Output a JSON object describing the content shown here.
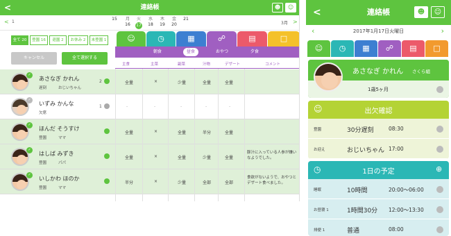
{
  "left": {
    "title": "連絡帳",
    "back_glyph": "<",
    "month_left": "1",
    "month_right": "3月",
    "days": [
      {
        "w": "",
        "d": "15"
      },
      {
        "w": "月",
        "d": "16"
      },
      {
        "w": "火",
        "d": "17"
      },
      {
        "w": "水",
        "d": "18"
      },
      {
        "w": "木",
        "d": "19"
      },
      {
        "w": "金",
        "d": "20"
      },
      {
        "w": "",
        "d": "21"
      }
    ],
    "filters": [
      "全て 20",
      "登園 16",
      "退園 2",
      "お休み 2",
      "未登園 1"
    ],
    "cancel_label": "キャンセル",
    "select_all_label": "全て選択する",
    "subtabs": [
      "朝食",
      "昼食",
      "おやつ",
      "夕食"
    ],
    "columns": [
      "主食",
      "主菜",
      "副菜",
      "汁物",
      "デザート",
      "コメント"
    ],
    "rows": [
      {
        "name": "あさなぎ かれん",
        "status": "遅刻",
        "pickup": "おじいちゃん",
        "count": "2",
        "cells": [
          "全量",
          "×",
          "少量",
          "全量",
          "全量"
        ],
        "comment": ""
      },
      {
        "name": "いずみ かんな",
        "status": "欠席",
        "pickup": "",
        "count": "1",
        "cells": [
          "-",
          "-",
          "-",
          "-",
          "-"
        ],
        "comment": ""
      },
      {
        "name": "ほんだ そうすけ",
        "status": "登園",
        "pickup": "ママ",
        "count": "",
        "cells": [
          "全量",
          "×",
          "全量",
          "半分",
          "全量"
        ],
        "comment": ""
      },
      {
        "name": "はしば みずき",
        "status": "登園",
        "pickup": "パパ",
        "count": "",
        "cells": [
          "全量",
          "×",
          "全量",
          "少量",
          "全量"
        ],
        "comment": "豚汁に入っている人参が嫌いなようでした。"
      },
      {
        "name": "いしかわ ほのか",
        "status": "登園",
        "pickup": "ママ",
        "count": "",
        "cells": [
          "半分",
          "×",
          "少量",
          "全部",
          "全部"
        ],
        "comment": "食欲がないようで、おやつとデザート食べました。"
      }
    ]
  },
  "right": {
    "title": "連絡帳",
    "date": "2017年1月17日火曜日",
    "child_name": "あさなぎ かれん",
    "class_name": "さくら組",
    "age": "1歳5ヶ月",
    "attendance_title": "出欠確認",
    "attendance_rows": [
      {
        "label": "登園",
        "value": "30分遅刻",
        "time": "08:30"
      },
      {
        "label": "お迎え",
        "value": "おじいちゃん",
        "time": "17:00"
      }
    ],
    "schedule_title": "1日の予定",
    "schedule_rows": [
      {
        "label": "睡眠",
        "value": "10時間",
        "time": "20:00〜06:00"
      },
      {
        "label": "お昼寝 1",
        "value": "1時間30分",
        "time": "12:00〜13:30"
      },
      {
        "label": "排便 1",
        "value": "普通",
        "time": "08:00"
      }
    ]
  },
  "colors": {
    "brand_green": "#5ec43f",
    "purple": "#a05fc1",
    "teal": "#2bb7b5",
    "blue": "#3d7fd1",
    "orange": "#f29a2e",
    "red": "#ec5a6a",
    "yellow": "#f4c12a",
    "lime": "#b4d335"
  }
}
